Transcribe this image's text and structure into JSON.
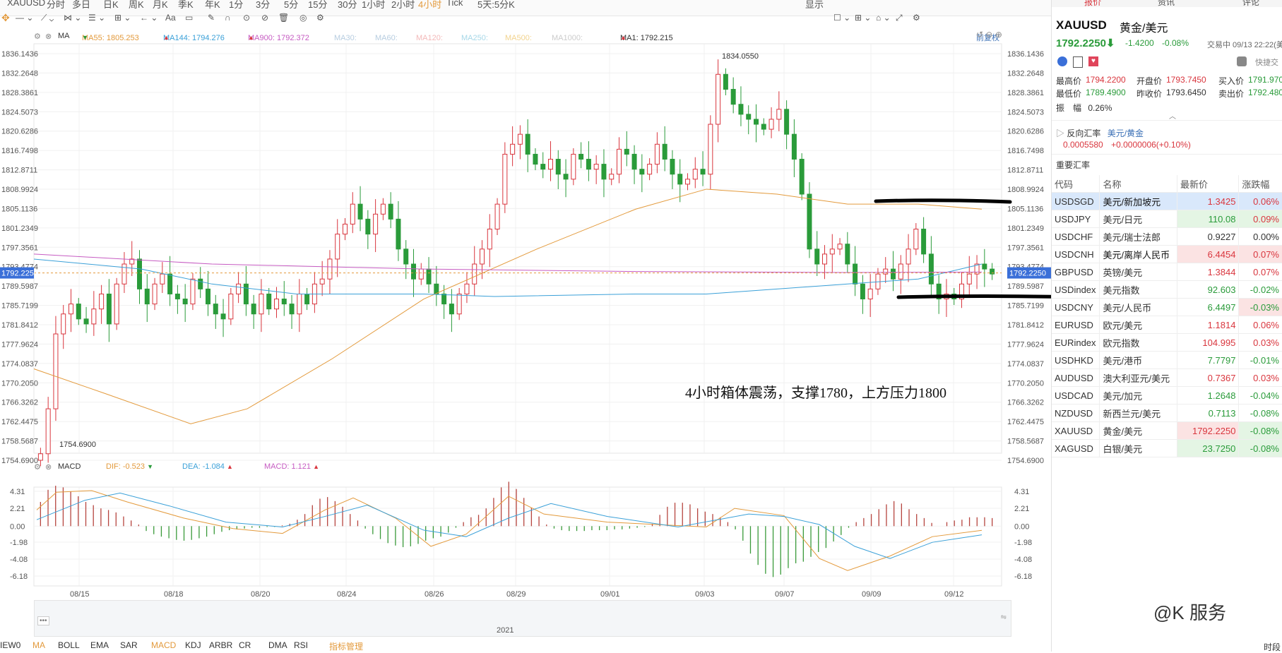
{
  "toolbar": {
    "symbol": "XAUUSD",
    "periods": [
      "分时",
      "多日",
      "日K",
      "周K",
      "月K",
      "季K",
      "年K",
      "1分",
      "3分",
      "5分",
      "15分",
      "30分",
      "1小时",
      "2小时",
      "4小时",
      "Tick",
      "5天:5分K"
    ],
    "active_period": "4小时",
    "right_items": [
      "显示"
    ]
  },
  "ma_row": {
    "label": "MA",
    "items": [
      {
        "text": "MA55: 1805.253",
        "color": "#e39a3c",
        "dir": "down"
      },
      {
        "text": "MA144: 1794.276",
        "color": "#3aa0d8",
        "dir": "up"
      },
      {
        "text": "MA900: 1792.372",
        "color": "#c65bc2",
        "dir": "up"
      },
      {
        "text": "MA30:",
        "color": "#b7cde0",
        "dir": ""
      },
      {
        "text": "MA60:",
        "color": "#b7cde0",
        "dir": ""
      },
      {
        "text": "MA120:",
        "color": "#f3b9b9",
        "dir": ""
      },
      {
        "text": "MA250:",
        "color": "#a7d8e8",
        "dir": ""
      },
      {
        "text": "MA500:",
        "color": "#f2d38e",
        "dir": ""
      },
      {
        "text": "MA1000:",
        "color": "#cccccc",
        "dir": ""
      },
      {
        "text": "MA1: 1792.215",
        "color": "#333333",
        "dir": "up"
      }
    ],
    "adjust_label": "前复权"
  },
  "price_axis": [
    "1836.1436",
    "1832.2648",
    "1828.3861",
    "1824.5073",
    "1820.6286",
    "1816.7498",
    "1812.8711",
    "1808.9924",
    "1805.1136",
    "1801.2349",
    "1797.3561",
    "1793.4774",
    "1789.5987",
    "1785.7199",
    "1781.8412",
    "1777.9624",
    "1774.0837",
    "1770.2050",
    "1766.3262",
    "1762.4475",
    "1758.5687",
    "1754.6900"
  ],
  "current_price_label": "1792.2250",
  "high_marker": "1834.0550",
  "low_marker": "1754.6900",
  "annotation": "4小时箱体震荡，支撑1780，上方压力1800",
  "macd_row": {
    "label": "MACD",
    "dif": "DIF: -0.523",
    "dea": "DEA: -1.084",
    "macd": "MACD: 1.121",
    "colors": {
      "dif": "#e39a3c",
      "dea": "#3aa0d8",
      "macd": "#c65bc2"
    }
  },
  "macd_axis": [
    "4.31",
    "2.21",
    "0.00",
    "-1.98",
    "-4.08",
    "-6.18"
  ],
  "date_axis": [
    "08/15",
    "08/18",
    "08/20",
    "08/24",
    "08/26",
    "08/29",
    "09/01",
    "09/03",
    "09/07",
    "09/09",
    "09/12"
  ],
  "nav_year": "2021",
  "indicators": [
    "MA",
    "BOLL",
    "EMA",
    "SAR",
    "MACD",
    "KDJ",
    "ARBR",
    "CR",
    "DMA",
    "RSI",
    "指标管理"
  ],
  "active_indicator": "MACD",
  "right_panel": {
    "tabs": [
      "报价",
      "资讯",
      "评论"
    ],
    "symbol": "XAUUSD",
    "name": "黄金/美元",
    "price": "1792.2250",
    "change": "-1.4200",
    "change_pct": "-0.08%",
    "status": "交易中 09/13 22:22(美",
    "quick_trade": "快捷交",
    "stats": [
      {
        "label": "最高价",
        "value": "1794.2200",
        "color": "red"
      },
      {
        "label": "开盘价",
        "value": "1793.7450",
        "color": "red"
      },
      {
        "label": "买入价",
        "value": "1791.970",
        "color": "green"
      },
      {
        "label": "最低价",
        "value": "1789.4900",
        "color": "green"
      },
      {
        "label": "昨收价",
        "value": "1793.6450",
        "color": "plain"
      },
      {
        "label": "卖出价",
        "value": "1792.480",
        "color": "green"
      }
    ],
    "amplitude_label": "振　幅",
    "amplitude": "0.26%",
    "reverse_label": "反向汇率",
    "reverse_pair": "美元/黄金",
    "reverse_value": "0.0005580",
    "reverse_change": "+0.0000006(+0.10%)",
    "section_title": "重要汇率",
    "table_headers": [
      "代码",
      "名称",
      "最新价",
      "涨跌幅"
    ],
    "rows": [
      {
        "code": "USDSGD",
        "name": "美元/新加坡元",
        "price": "1.3425",
        "chg": "0.06%",
        "pc": "red",
        "cc": "red",
        "pb": "",
        "cb": "",
        "sel": true
      },
      {
        "code": "USDJPY",
        "name": "美元/日元",
        "price": "110.08",
        "chg": "0.09%",
        "pc": "green",
        "cc": "red",
        "pb": "box-green",
        "cb": "box-green",
        "sel": false
      },
      {
        "code": "USDCHF",
        "name": "美元/瑞士法郎",
        "price": "0.9227",
        "chg": "0.00%",
        "pc": "plain",
        "cc": "plain",
        "pb": "",
        "cb": "",
        "sel": false
      },
      {
        "code": "USDCNH",
        "name": "美元/离岸人民币",
        "price": "6.4454",
        "chg": "0.07%",
        "pc": "red",
        "cc": "red",
        "pb": "box-red",
        "cb": "box-red",
        "sel": false
      },
      {
        "code": "GBPUSD",
        "name": "英镑/美元",
        "price": "1.3844",
        "chg": "0.07%",
        "pc": "red",
        "cc": "red",
        "pb": "",
        "cb": "",
        "sel": false
      },
      {
        "code": "USDindex",
        "name": "美元指数",
        "price": "92.603",
        "chg": "-0.02%",
        "pc": "green",
        "cc": "green",
        "pb": "",
        "cb": "",
        "sel": false
      },
      {
        "code": "USDCNY",
        "name": "美元/人民币",
        "price": "6.4497",
        "chg": "-0.03%",
        "pc": "green",
        "cc": "green",
        "pb": "",
        "cb": "box-red",
        "sel": false
      },
      {
        "code": "EURUSD",
        "name": "欧元/美元",
        "price": "1.1814",
        "chg": "0.06%",
        "pc": "red",
        "cc": "red",
        "pb": "",
        "cb": "",
        "sel": false
      },
      {
        "code": "EURindex",
        "name": "欧元指数",
        "price": "104.995",
        "chg": "0.03%",
        "pc": "red",
        "cc": "red",
        "pb": "",
        "cb": "",
        "sel": false
      },
      {
        "code": "USDHKD",
        "name": "美元/港币",
        "price": "7.7797",
        "chg": "-0.01%",
        "pc": "green",
        "cc": "green",
        "pb": "",
        "cb": "",
        "sel": false
      },
      {
        "code": "AUDUSD",
        "name": "澳大利亚元/美元",
        "price": "0.7367",
        "chg": "0.03%",
        "pc": "red",
        "cc": "red",
        "pb": "",
        "cb": "",
        "sel": false
      },
      {
        "code": "USDCAD",
        "name": "美元/加元",
        "price": "1.2648",
        "chg": "-0.04%",
        "pc": "green",
        "cc": "green",
        "pb": "",
        "cb": "",
        "sel": false
      },
      {
        "code": "NZDUSD",
        "name": "新西兰元/美元",
        "price": "0.7113",
        "chg": "-0.08%",
        "pc": "green",
        "cc": "green",
        "pb": "",
        "cb": "",
        "sel": false
      },
      {
        "code": "XAUUSD",
        "name": "黄金/美元",
        "price": "1792.2250",
        "chg": "-0.08%",
        "pc": "red",
        "cc": "green",
        "pb": "box-red",
        "cb": "box-green",
        "sel": false
      },
      {
        "code": "XAGUSD",
        "name": "白银/美元",
        "price": "23.7250",
        "chg": "-0.08%",
        "pc": "green",
        "cc": "green",
        "pb": "box-green",
        "cb": "box-green",
        "sel": false
      }
    ]
  },
  "watermark": "@K 服务",
  "bottom_right": "时段"
}
